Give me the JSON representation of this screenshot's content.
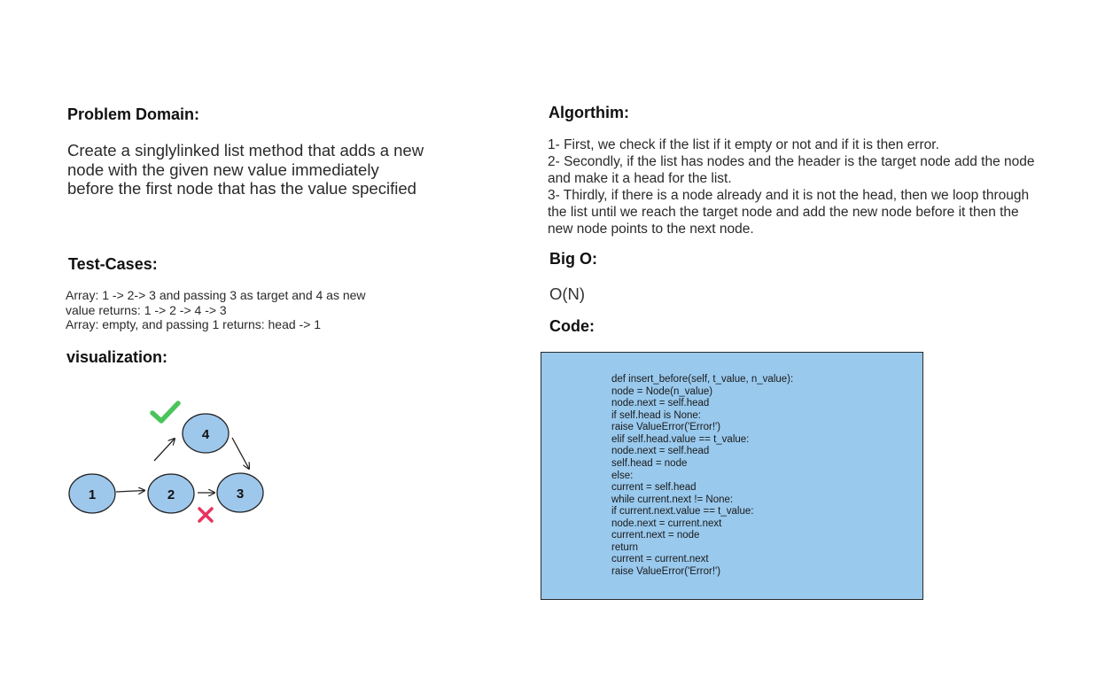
{
  "problem": {
    "title": "Problem Domain:",
    "lines": [
      "Create a singlylinked list method that adds a new",
      "node with the given new value immediately",
      "before the first node that has the value specified"
    ]
  },
  "test_cases": {
    "title": "Test-Cases:",
    "lines": [
      "Array: 1 -> 2-> 3 and passing 3 as target and 4 as new",
      "value returns: 1 -> 2 -> 4 -> 3",
      "Array: empty, and passing 1 returns: head -> 1"
    ]
  },
  "visualization": {
    "title": "visualization:",
    "nodes": {
      "n1": "1",
      "n2": "2",
      "n3": "3",
      "n4": "4"
    },
    "colors": {
      "node_fill": "#9ec7ec",
      "node_stroke": "#222222",
      "check": "#4bc45b",
      "cross": "#e8325f"
    },
    "icons": [
      "check-icon",
      "cross-icon"
    ]
  },
  "algorithm": {
    "title": "Algorthim:",
    "lines": [
      "1- First, we check if the list if it empty or not and if it is then error.",
      "2- Secondly, if the list has nodes and the header is the target node add the node",
      "and make it a head for the list.",
      "3- Thirdly, if there is a node already and it is not the head, then we loop through",
      "the list until we reach the target node and add the new node before it then the",
      "new node points to the next node."
    ]
  },
  "big_o": {
    "title": "Big O:",
    "value": "O(N)"
  },
  "code": {
    "title": "Code:",
    "background": "#99c9ed",
    "lines": [
      "def insert_before(self, t_value, n_value):",
      "        node = Node(n_value)",
      "        node.next = self.head",
      "        if self.head is None:",
      "            raise ValueError('Error!')",
      "        elif self.head.value == t_value:",
      "            node.next = self.head",
      "            self.head = node",
      "        else:",
      "            current = self.head",
      "            while current.next != None:",
      "                if current.next.value == t_value:",
      "                    node.next = current.next",
      "                    current.next = node",
      "                    return",
      "                current = current.next",
      "            raise ValueError('Error!')"
    ]
  }
}
